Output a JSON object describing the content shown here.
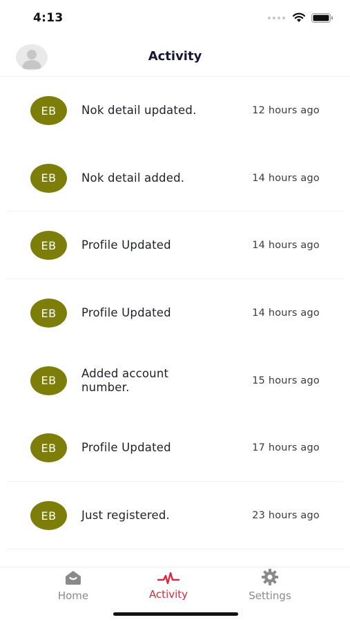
{
  "status_bar": {
    "time": "4:13"
  },
  "header": {
    "title": "Activity"
  },
  "activities": [
    {
      "initials": "EB",
      "text": "Nok detail updated.",
      "time": "12 hours ago"
    },
    {
      "initials": "EB",
      "text": "Nok detail added.",
      "time": "14 hours ago"
    },
    {
      "initials": "EB",
      "text": "Profile Updated",
      "time": "14 hours ago"
    },
    {
      "initials": "EB",
      "text": "Profile Updated",
      "time": "14 hours ago"
    },
    {
      "initials": "EB",
      "text": "Added account number.",
      "time": "15 hours ago"
    },
    {
      "initials": "EB",
      "text": "Profile Updated",
      "time": "17 hours ago"
    },
    {
      "initials": "EB",
      "text": "Just registered.",
      "time": "23 hours ago"
    }
  ],
  "tab_bar": {
    "home": {
      "label": "Home",
      "icon": "home-icon"
    },
    "activity": {
      "label": "Activity",
      "icon": "activity-pulse-icon",
      "active": true
    },
    "settings": {
      "label": "Settings",
      "icon": "gear-icon"
    }
  },
  "colors": {
    "badge": "#7d7d0a",
    "active_tab": "#e0263a",
    "title": "#16163a",
    "inactive_tab": "#8a8a8a"
  }
}
